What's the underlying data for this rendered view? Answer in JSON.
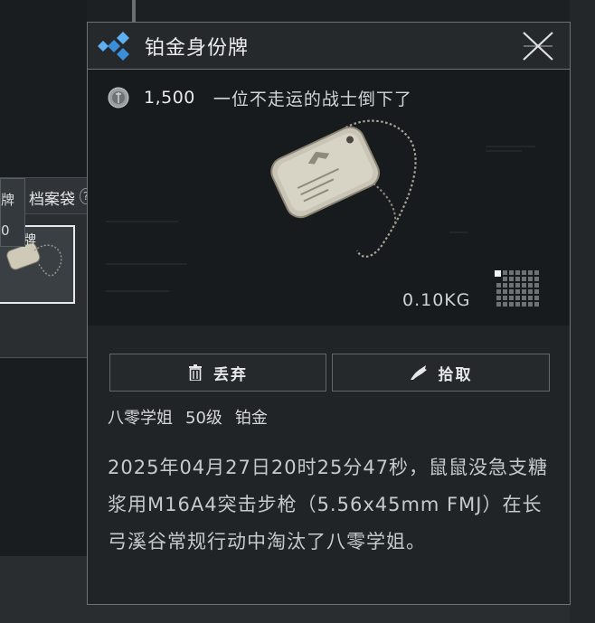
{
  "popup": {
    "title": "铂金身份牌",
    "header_icon": "diamonds-icon",
    "close_icon": "close-icon",
    "price": "1,500",
    "price_icon": "coin-icon",
    "flavor_text": "一位不走运的战士倒下了",
    "weight": "0.10KG",
    "size_icon": "grid-size-icon",
    "buttons": {
      "discard": "丢弃",
      "discard_icon": "trash-icon",
      "pickup": "拾取",
      "pickup_icon": "grab-hand-icon"
    },
    "meta": {
      "owner": "八零学姐",
      "level": "50级",
      "tier": "铂金"
    },
    "description": "2025年04月27日20时25分47秒，鼠鼠没急支糖浆用M16A4突击步枪（5.56x45mm FMJ）在长弓溪谷常规行动中淘汰了八零学姐。"
  },
  "background": {
    "case_title": "档案袋",
    "case_help": "?",
    "tooltip_line1": "牌",
    "tooltip_line2": "0",
    "slot_label": "牌"
  },
  "colors": {
    "accent_blue": "#3a8fd8",
    "panel_bg": "#202427",
    "border": "#6d7276"
  }
}
